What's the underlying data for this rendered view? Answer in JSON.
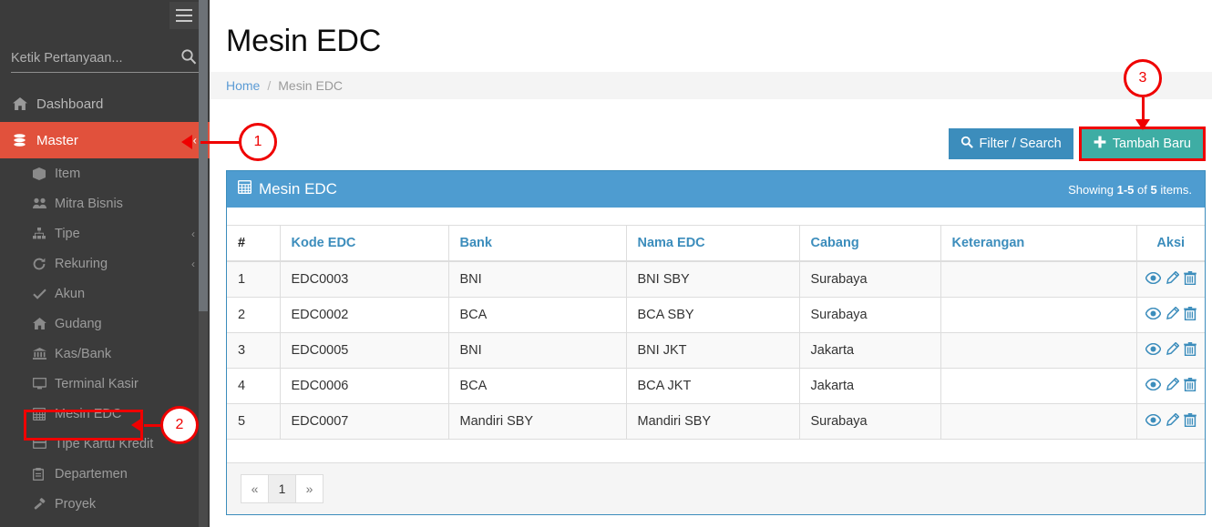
{
  "sidebar": {
    "hamburger_icon": "hamburger-icon",
    "search": {
      "placeholder": "Ketik Pertanyaan...",
      "value": "",
      "icon": "search-icon"
    },
    "items": [
      {
        "label": "Dashboard",
        "icon": "home-icon",
        "level": "top",
        "active": false,
        "caret": ""
      },
      {
        "label": "Master",
        "icon": "database-icon",
        "level": "top",
        "active": true,
        "caret": "‹"
      },
      {
        "label": "Item",
        "icon": "cube-icon",
        "level": "sub",
        "active": false,
        "caret": ""
      },
      {
        "label": "Mitra Bisnis",
        "icon": "users-icon",
        "level": "sub",
        "active": false,
        "caret": ""
      },
      {
        "label": "Tipe",
        "icon": "sitemap-icon",
        "level": "sub",
        "active": false,
        "caret": "‹"
      },
      {
        "label": "Rekuring",
        "icon": "refresh-icon",
        "level": "sub",
        "active": false,
        "caret": "‹"
      },
      {
        "label": "Akun",
        "icon": "check-icon",
        "level": "sub",
        "active": false,
        "caret": ""
      },
      {
        "label": "Gudang",
        "icon": "home-icon",
        "level": "sub",
        "active": false,
        "caret": ""
      },
      {
        "label": "Kas/Bank",
        "icon": "bank-icon",
        "level": "sub",
        "active": false,
        "caret": ""
      },
      {
        "label": "Terminal Kasir",
        "icon": "desktop-icon",
        "level": "sub",
        "active": false,
        "caret": ""
      },
      {
        "label": "Mesin EDC",
        "icon": "calculator-icon",
        "level": "sub",
        "active": false,
        "caret": ""
      },
      {
        "label": "Tipe Kartu Kredit",
        "icon": "credit-card-icon",
        "level": "sub",
        "active": false,
        "caret": ""
      },
      {
        "label": "Departemen",
        "icon": "clipboard-icon",
        "level": "sub",
        "active": false,
        "caret": ""
      },
      {
        "label": "Proyek",
        "icon": "gavel-icon",
        "level": "sub",
        "active": false,
        "caret": ""
      }
    ]
  },
  "header": {
    "title": "Mesin EDC",
    "breadcrumb": {
      "home": "Home",
      "separator": "/",
      "current": "Mesin EDC"
    }
  },
  "toolbar": {
    "filter_label": "Filter / Search",
    "filter_icon": "search-icon",
    "add_label": "Tambah Baru",
    "add_icon": "plus-icon"
  },
  "panel": {
    "title": "Mesin EDC",
    "title_icon": "calculator-icon",
    "showing_prefix": "Showing ",
    "showing_range": "1-5",
    "showing_mid": " of ",
    "showing_total": "5",
    "showing_suffix": " items."
  },
  "table": {
    "columns": [
      "#",
      "Kode EDC",
      "Bank",
      "Nama EDC",
      "Cabang",
      "Keterangan",
      "Aksi"
    ],
    "rows": [
      {
        "num": "1",
        "kode": "EDC0003",
        "bank": "BNI",
        "nama": "BNI SBY",
        "cabang": "Surabaya",
        "keterangan": ""
      },
      {
        "num": "2",
        "kode": "EDC0002",
        "bank": "BCA",
        "nama": "BCA SBY",
        "cabang": "Surabaya",
        "keterangan": ""
      },
      {
        "num": "3",
        "kode": "EDC0005",
        "bank": "BNI",
        "nama": "BNI JKT",
        "cabang": "Jakarta",
        "keterangan": ""
      },
      {
        "num": "4",
        "kode": "EDC0006",
        "bank": "BCA",
        "nama": "BCA JKT",
        "cabang": "Jakarta",
        "keterangan": ""
      },
      {
        "num": "5",
        "kode": "EDC0007",
        "bank": "Mandiri SBY",
        "nama": "Mandiri SBY",
        "cabang": "Surabaya",
        "keterangan": ""
      }
    ],
    "action_icons": [
      "view-eye-icon",
      "edit-pencil-icon",
      "delete-trash-icon"
    ]
  },
  "pagination": {
    "prev": "«",
    "pages": [
      "1"
    ],
    "next": "»",
    "current": "1"
  },
  "annotations": [
    {
      "number": "1",
      "target": "sidebar-item-master"
    },
    {
      "number": "2",
      "target": "sidebar-item-mesin-edc"
    },
    {
      "number": "3",
      "target": "add-new-button"
    }
  ],
  "colors": {
    "sidebar_bg": "#3b3b3b",
    "active_menu": "#e1513c",
    "panel_header": "#4e9cd0",
    "filter_button": "#3c8dbc",
    "add_button": "#3eada4",
    "annotation": "#ef0000",
    "link": "#3c8dbc"
  }
}
